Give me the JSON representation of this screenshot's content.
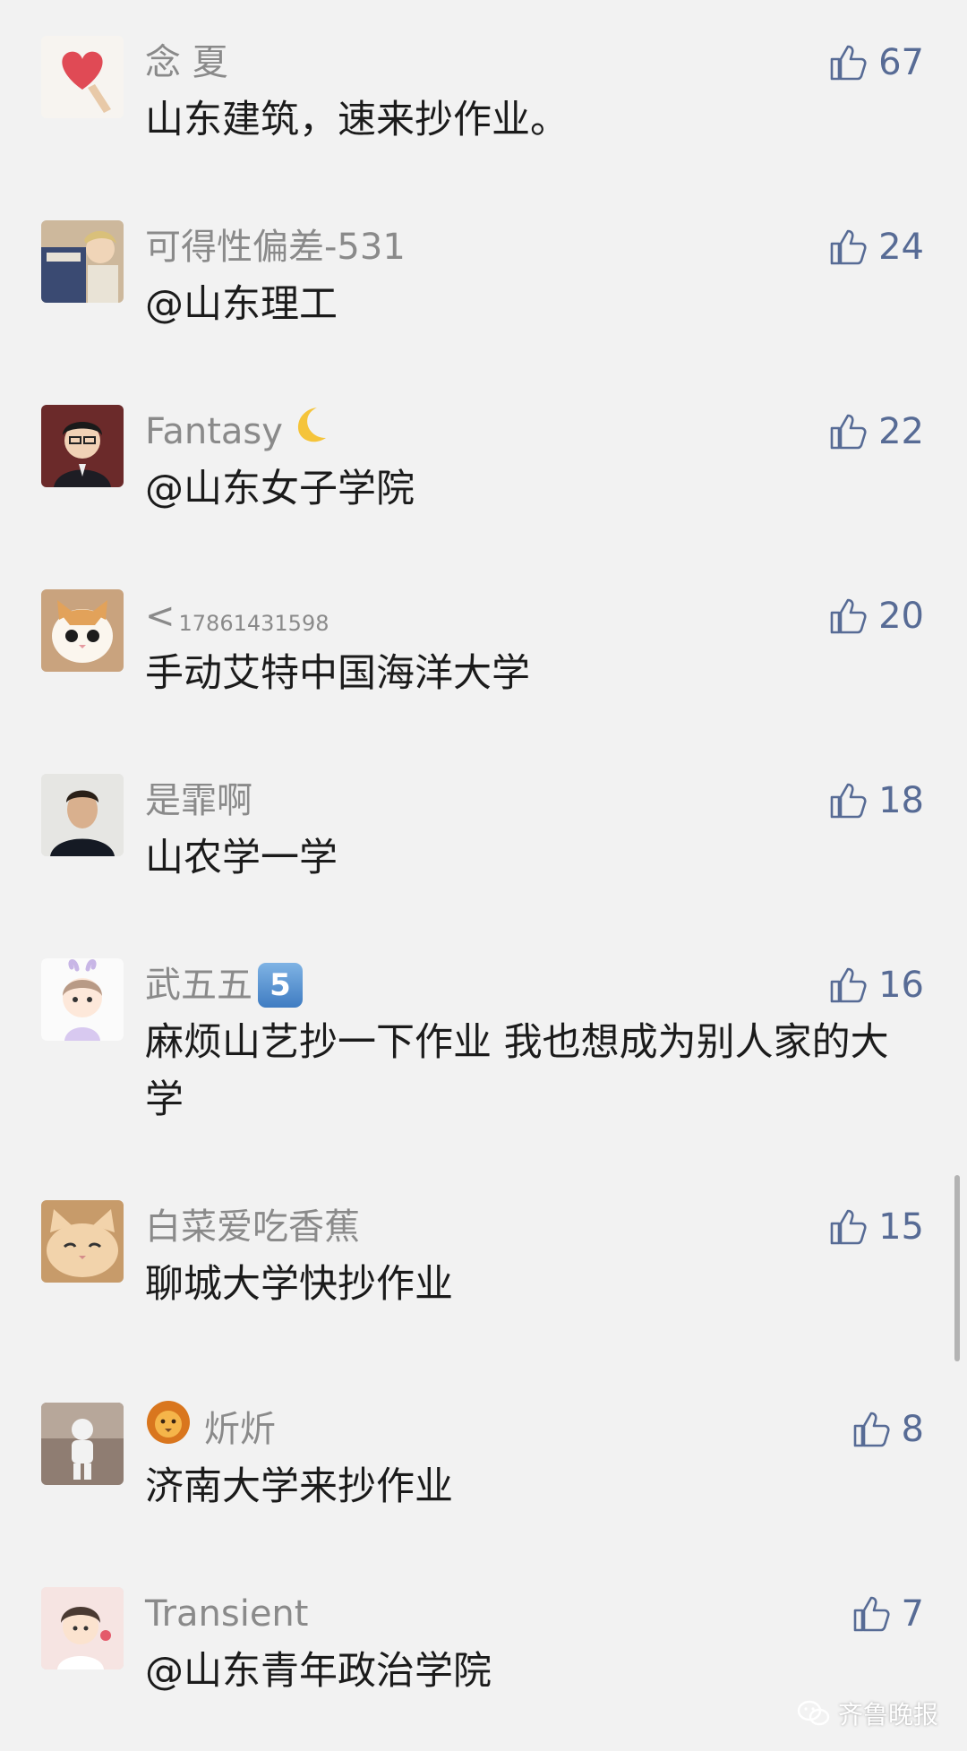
{
  "comments": [
    {
      "name": "念 夏",
      "text": "山东建筑，速来抄作业。",
      "likes": "67"
    },
    {
      "name": "可得性偏差-531",
      "text": "@山东理工",
      "likes": "24"
    },
    {
      "name": "Fantasy",
      "name_emoji": "🌙",
      "text": "@山东女子学院",
      "likes": "22"
    },
    {
      "name": "<",
      "name_suffix": "17861431598",
      "text": "手动艾特中国海洋大学",
      "likes": "20"
    },
    {
      "name": "是霏啊",
      "text": "山农学一学",
      "likes": "18"
    },
    {
      "name": "武五五",
      "name_badge": "5",
      "text": "麻烦山艺抄一下作业 我也想成为别人家的大学",
      "likes": "16"
    },
    {
      "name": "白菜爱吃香蕉",
      "text": "聊城大学快抄作业",
      "likes": "15"
    },
    {
      "name_emoji_prefix": "🦁",
      "name": "炘炘",
      "text": "济南大学来抄作业",
      "likes": "8"
    },
    {
      "name": "Transient",
      "text": "@山东青年政治学院",
      "likes": "7"
    }
  ],
  "watermark": "齐鲁晚报",
  "colors": {
    "background": "#f2f2f2",
    "like_blue": "#576b95",
    "name_gray": "#8a8a8a",
    "text_dark": "#1b1b1b"
  }
}
